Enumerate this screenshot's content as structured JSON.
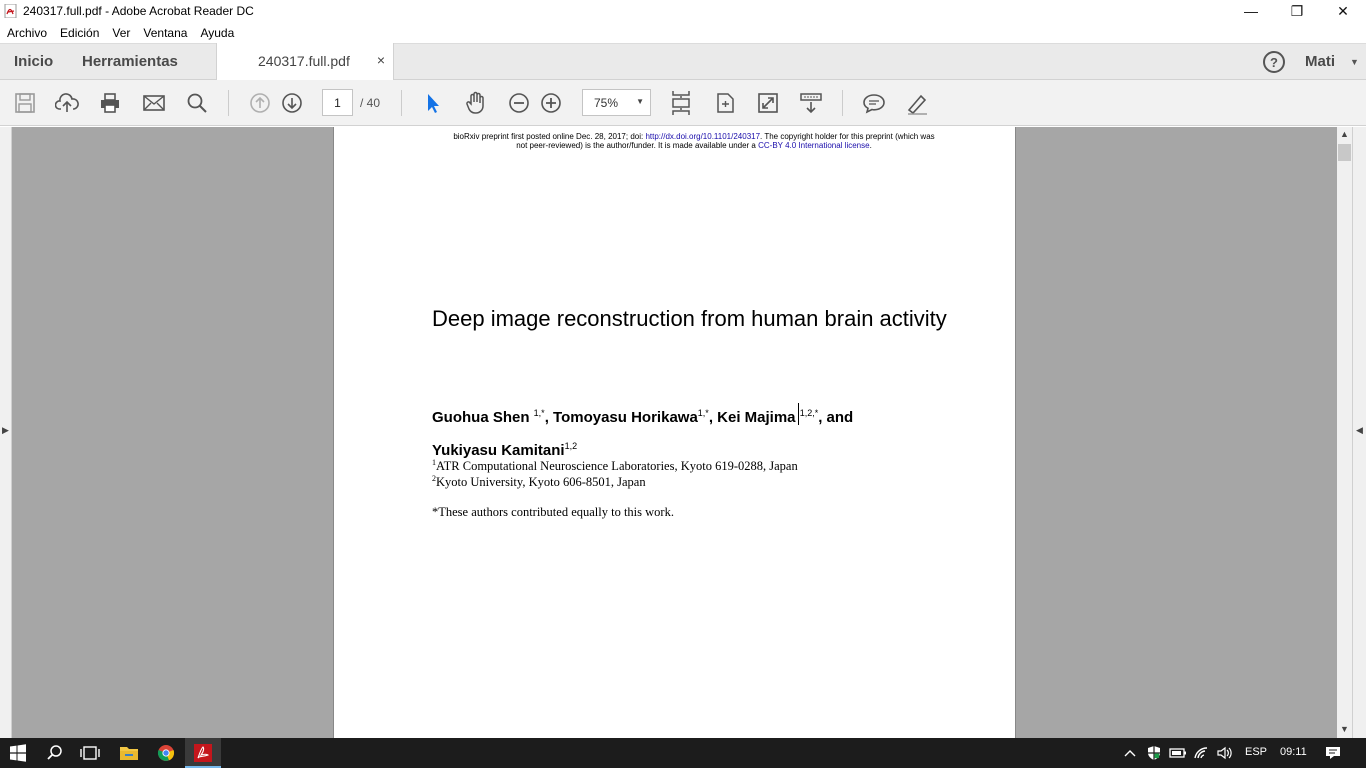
{
  "window": {
    "title": "240317.full.pdf - Adobe Acrobat Reader DC",
    "controls": {
      "minimize": "—",
      "restore": "❐",
      "close": "✕"
    }
  },
  "menu": [
    "Archivo",
    "Edición",
    "Ver",
    "Ventana",
    "Ayuda"
  ],
  "tabs": {
    "home": "Inicio",
    "tools": "Herramientas",
    "document": "240317.full.pdf",
    "close_symbol": "×",
    "help_symbol": "?",
    "user": "Mati"
  },
  "toolbar": {
    "icons": [
      "save-icon",
      "upload-cloud-icon",
      "print-icon",
      "email-icon",
      "search-icon",
      "page-up-icon",
      "page-down-icon",
      "select-cursor-icon",
      "hand-icon",
      "zoom-out-icon",
      "zoom-in-icon",
      "scroll-mode-icon",
      "fit-page-icon",
      "fullscreen-icon",
      "read-mode-icon",
      "comment-icon",
      "highlight-icon"
    ],
    "page_current": "1",
    "page_total": "/ 40",
    "zoom": "75%"
  },
  "document": {
    "preprint_line1_a": "bioRxiv preprint first posted online Dec. 28, 2017; doi: ",
    "preprint_doi": "http://dx.doi.org/10.1101/240317",
    "preprint_line1_b": ". The copyright holder for this preprint (which was",
    "preprint_line2_a": "not peer-reviewed) is the author/funder. It is made available under a ",
    "preprint_license": "CC-BY 4.0 International license",
    "preprint_line2_b": ".",
    "title": "Deep image reconstruction from human brain activity",
    "authors": [
      {
        "name": "Guohua Shen",
        "sup": "1,*",
        "after": ", "
      },
      {
        "name": "Tomoyasu Horikawa",
        "sup": "1,*",
        "after": ", "
      },
      {
        "name": "Kei Majima",
        "sup": "1,2,*",
        "after": ", and "
      },
      {
        "name": "Yukiyasu Kamitani",
        "sup": "1,2",
        "after": ""
      }
    ],
    "affiliations": [
      {
        "sup": "1",
        "text": "ATR Computational Neuroscience Laboratories, Kyoto 619-0288, Japan"
      },
      {
        "sup": "2",
        "text": "Kyoto University, Kyoto 606-8501, Japan"
      }
    ],
    "note": "*These authors contributed equally to this work."
  },
  "taskbar": {
    "apps": [
      "windows-start-icon",
      "search-icon",
      "task-view-icon",
      "file-explorer-icon",
      "chrome-icon",
      "acrobat-icon"
    ],
    "tray": {
      "language": "ESP",
      "time": "09:11"
    }
  },
  "colors": {
    "acrobat_red": "#c4161c",
    "link_blue": "#1a0dab",
    "taskbar": "#1c1c1c",
    "doc_bg": "#a6a6a6"
  }
}
